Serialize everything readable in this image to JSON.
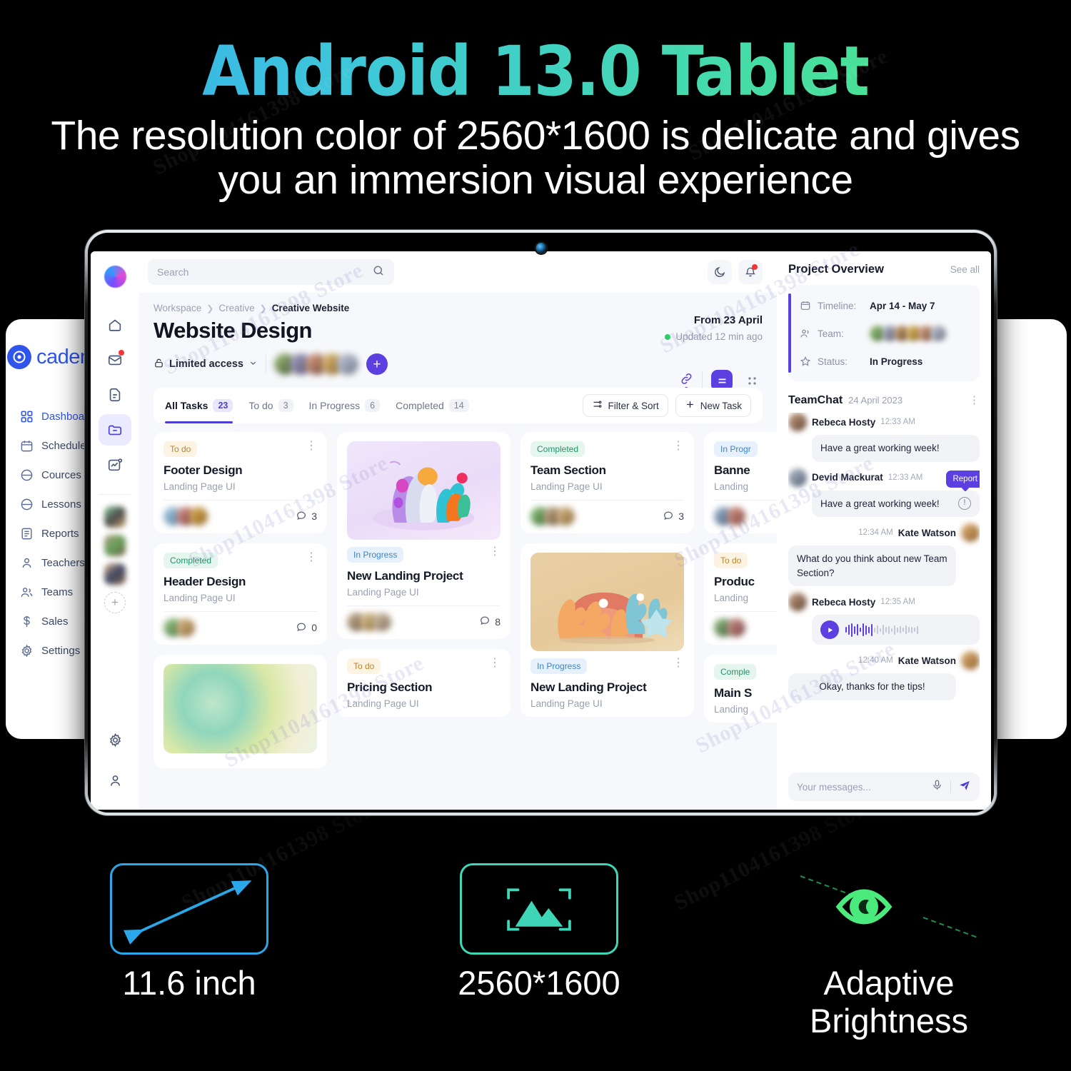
{
  "hero": {
    "title": "Android 13.0 Tablet",
    "subtitle": "The resolution color of 2560*1600 is delicate and gives you an immersion visual experience",
    "title_gradient_from": "#35a9f0",
    "title_gradient_to": "#4bea7c"
  },
  "academia_panel": {
    "logo_text": "cademi",
    "items": [
      {
        "label": "Dashboard",
        "icon": "grid-icon",
        "active": true
      },
      {
        "label": "Schedule",
        "icon": "calendar-icon",
        "active": false
      },
      {
        "label": "Cources",
        "icon": "course-icon",
        "active": false
      },
      {
        "label": "Lessons",
        "icon": "lesson-icon",
        "active": false
      },
      {
        "label": "Reports",
        "icon": "report-icon",
        "active": false
      },
      {
        "label": "Teachers",
        "icon": "user-icon",
        "active": false
      },
      {
        "label": "Teams",
        "icon": "users-icon",
        "active": false
      },
      {
        "label": "Sales",
        "icon": "dollar-icon",
        "active": false
      },
      {
        "label": "Settings",
        "icon": "gear-icon",
        "active": false
      }
    ]
  },
  "app": {
    "rail": {
      "icons": [
        "home-icon",
        "mail-icon",
        "document-icon",
        "folder-icon",
        "analytics-icon"
      ],
      "bottom_icons": [
        "gear-icon",
        "profile-icon"
      ],
      "add_label": "+"
    },
    "search": {
      "placeholder": "Search"
    },
    "breadcrumb": {
      "root": "Workspace",
      "mid": "Creative",
      "current": "Creative Website"
    },
    "page_title": "Website Design",
    "access": {
      "label": "Limited access"
    },
    "from_date": "From 23 April",
    "updated": "Updated 12 min ago",
    "copy_link_tooltip": "Copy Link",
    "tabs": [
      {
        "label": "All Tasks",
        "count": "23",
        "active": true
      },
      {
        "label": "To do",
        "count": "3",
        "active": false
      },
      {
        "label": "In Progress",
        "count": "6",
        "active": false
      },
      {
        "label": "Completed",
        "count": "14",
        "active": false
      }
    ],
    "filter_label": "Filter & Sort",
    "new_task_label": "New Task",
    "columns": [
      {
        "cards": [
          {
            "status": "To do",
            "status_kind": "todo",
            "title": "Footer Design",
            "subtitle": "Landing Page UI",
            "comments": "3",
            "thumb": null
          },
          {
            "status": "Completed",
            "status_kind": "done",
            "title": "Header Design",
            "subtitle": "Landing Page UI",
            "comments": "0",
            "thumb": null
          },
          {
            "status": "",
            "status_kind": "none",
            "title": "",
            "subtitle": "",
            "comments": "",
            "thumb": "butterfly"
          }
        ]
      },
      {
        "cards": [
          {
            "status": "In Progress",
            "status_kind": "prog",
            "title": "New Landing Project",
            "subtitle": "Landing Page UI",
            "comments": "8",
            "thumb": "coral-purple"
          },
          {
            "status": "To do",
            "status_kind": "todo",
            "title": "Pricing Section",
            "subtitle": "Landing Page UI",
            "comments": "",
            "thumb": null
          }
        ]
      },
      {
        "cards": [
          {
            "status": "Completed",
            "status_kind": "done",
            "title": "Team Section",
            "subtitle": "Landing Page UI",
            "comments": "3",
            "thumb": null
          },
          {
            "status": "In Progress",
            "status_kind": "prog",
            "title": "New Landing Project",
            "subtitle": "Landing Page UI",
            "comments": "",
            "thumb": "coral-orange"
          }
        ]
      },
      {
        "cards": [
          {
            "status": "In Progr",
            "status_kind": "prog",
            "title": "Banne",
            "subtitle": "Landing",
            "comments": "",
            "thumb": null
          },
          {
            "status": "To do",
            "status_kind": "todo",
            "title": "Produc",
            "subtitle": "Landing",
            "comments": "",
            "thumb": null
          },
          {
            "status": "Comple",
            "status_kind": "done",
            "title": "Main S",
            "subtitle": "Landing",
            "comments": "",
            "thumb": null
          }
        ]
      }
    ],
    "right_panel": {
      "title": "Project Overview",
      "see_all": "See all",
      "overview": [
        {
          "icon": "calendar-icon",
          "label": "Timeline:",
          "value": "Apr 14 - May 7"
        },
        {
          "icon": "users-icon",
          "label": "Team:",
          "value": ""
        },
        {
          "icon": "star-icon",
          "label": "Status:",
          "value": "In Progress"
        }
      ],
      "chat": {
        "title": "TeamChat",
        "date": "24 April 2023",
        "report_tooltip": "Report",
        "messages": [
          {
            "side": "left",
            "name": "Rebeca Hosty",
            "time": "12:33 AM",
            "text": "Have a great working week!",
            "type": "text"
          },
          {
            "side": "left",
            "name": "Devid Mackurat",
            "time": "12:33 AM",
            "text": "Have a great working week!",
            "type": "text",
            "reported": true
          },
          {
            "side": "right",
            "name": "Kate Watson",
            "time": "12:34 AM",
            "text": "What do you think about new Team Section?",
            "type": "text"
          },
          {
            "side": "left",
            "name": "Rebeca Hosty",
            "time": "12:35 AM",
            "text": "",
            "type": "voice"
          },
          {
            "side": "right",
            "name": "Kate Watson",
            "time": "12:40 AM",
            "text": "Okay, thanks for the tips!",
            "type": "text"
          }
        ],
        "composer_placeholder": "Your messages..."
      }
    }
  },
  "features": [
    {
      "label": "11.6 inch",
      "icon": "diagonal-arrow-icon",
      "color": "#2aa7e8"
    },
    {
      "label": "2560*1600",
      "icon": "image-frame-icon",
      "color": "#3fd6b8"
    },
    {
      "label": "Adaptive\nBrightness",
      "icon": "eye-icon",
      "color": "#4bea7c"
    }
  ],
  "watermark": {
    "text": "Shop1104161398 Store"
  }
}
